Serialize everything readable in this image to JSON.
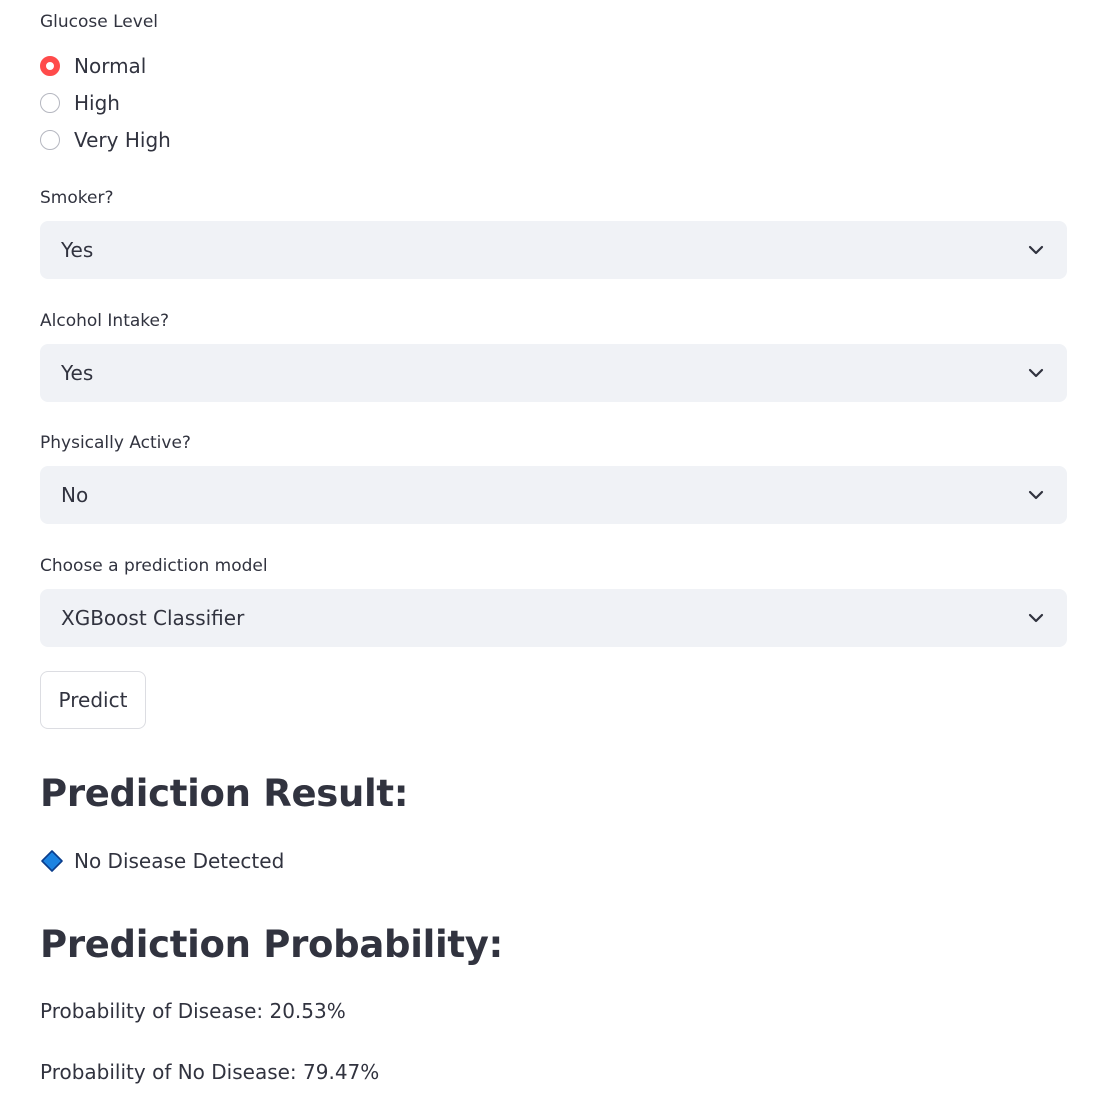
{
  "glucose": {
    "label": "Glucose Level",
    "options": [
      "Normal",
      "High",
      "Very High"
    ],
    "selected": "Normal"
  },
  "smoker": {
    "label": "Smoker?",
    "value": "Yes"
  },
  "alcohol": {
    "label": "Alcohol Intake?",
    "value": "Yes"
  },
  "active": {
    "label": "Physically Active?",
    "value": "No"
  },
  "model": {
    "label": "Choose a prediction model",
    "value": "XGBoost Classifier"
  },
  "predict_button": {
    "label": "Predict"
  },
  "result": {
    "heading": "Prediction Result:",
    "icon": "blue-diamond-icon",
    "text": "No Disease Detected"
  },
  "probability": {
    "heading": "Prediction Probability:",
    "disease": "Probability of Disease: 20.53%",
    "no_disease": "Probability of No Disease: 79.47%"
  },
  "colors": {
    "accent": "#ff4b4b",
    "select_bg": "#f0f2f6",
    "text": "#31333f",
    "diamond": "#1c83e1"
  }
}
